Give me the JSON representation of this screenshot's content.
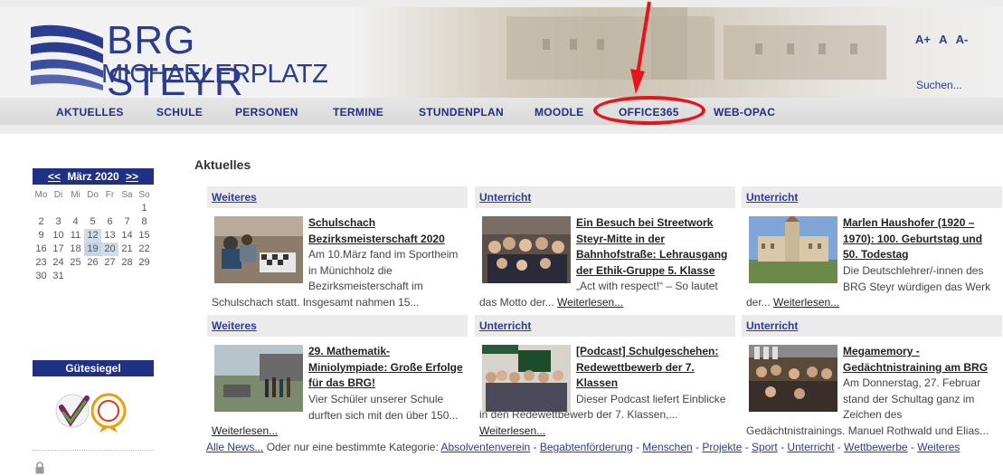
{
  "header": {
    "logo_line1": "BRG STEYR",
    "logo_line2": "MICHAELERPLATZ",
    "font_sizes": [
      "A+",
      "A",
      "A-"
    ],
    "search_label": "Suchen..."
  },
  "nav": {
    "items": [
      "AKTUELLES",
      "SCHULE",
      "PERSONEN",
      "TERMINE",
      "STUNDENPLAN",
      "MOODLE",
      "OFFICE365",
      "WEB-OPAC"
    ]
  },
  "annotation": {
    "color": "#e8141b"
  },
  "sidebar": {
    "calendar": {
      "prev": "<<",
      "month": "März 2020",
      "next": ">>",
      "weekdays": [
        "Mo",
        "Di",
        "Mi",
        "Do",
        "Fr",
        "Sa",
        "So"
      ],
      "weeks": [
        [
          "",
          "",
          "",
          "",
          "",
          "",
          "1"
        ],
        [
          "2",
          "3",
          "4",
          "5",
          "6",
          "7",
          "8"
        ],
        [
          "9",
          "10",
          "11",
          "12",
          "13",
          "14",
          "15"
        ],
        [
          "16",
          "17",
          "18",
          "19",
          "20",
          "21",
          "22"
        ],
        [
          "23",
          "24",
          "25",
          "26",
          "27",
          "28",
          "29"
        ],
        [
          "30",
          "31",
          "",
          "",
          "",
          "",
          ""
        ]
      ]
    },
    "guetesiegel_title": "Gütesiegel"
  },
  "main": {
    "title": "Aktuelles",
    "cards": [
      {
        "category": "Weiteres",
        "title": "Schulschach Bezirksmeisterschaft 2020",
        "teaser": "Am 10.März fand im Sportheim in Münichholz die Bezirksmeisterschaft im",
        "bottom": "Schulschach statt. Insgesamt nahmen 15...",
        "read_more": ""
      },
      {
        "category": "Unterricht",
        "title": "Ein Besuch bei Streetwork Steyr-Mitte in der Bahnhofstraße: Lehrausgang der Ethik-Gruppe 5. Klasse",
        "teaser": "„Act with respect!“ – So lautet",
        "bottom": "das Motto der... ",
        "read_more": "Weiterlesen..."
      },
      {
        "category": "Unterricht",
        "title": "Marlen Haushofer (1920 – 1970): 100. Geburtstag und 50. Todestag",
        "teaser": "Die Deutschlehrer/-innen des BRG Steyr würdigen das Werk",
        "bottom": "der... ",
        "read_more": "Weiterlesen..."
      },
      {
        "category": "Weiteres",
        "title": "29. Mathematik-Miniolympiade: Große Erfolge für das BRG!",
        "teaser": "Vier Schüler unserer Schule durften sich mit den über 150...",
        "bottom": "",
        "read_more": "Weiterlesen..."
      },
      {
        "category": "Unterricht",
        "title": "[Podcast] Schulgeschehen: Redewettbewerb der 7. Klassen",
        "teaser": "Dieser Podcast liefert Einblicke",
        "bottom": "in den Redewettbewerb der 7. Klassen,... ",
        "read_more": "Weiterlesen..."
      },
      {
        "category": "Unterricht",
        "title": "Megamemory - Gedächtnistraining am BRG",
        "teaser": "Am Donnerstag, 27. Februar stand der Schultag ganz im Zeichen des",
        "bottom": "Gedächtnistrainings. Manuel Rothwald und Elias...",
        "read_more": ""
      }
    ],
    "footer": {
      "all_news": "Alle News...",
      "intro": " Oder nur eine bestimmte Kategorie: ",
      "categories": [
        "Absolventenverein",
        "Begabtenförderung",
        "Menschen",
        "Projekte",
        "Sport",
        "Unterricht",
        "Wettbewerbe",
        "Weiteres"
      ],
      "separator": " - "
    }
  }
}
